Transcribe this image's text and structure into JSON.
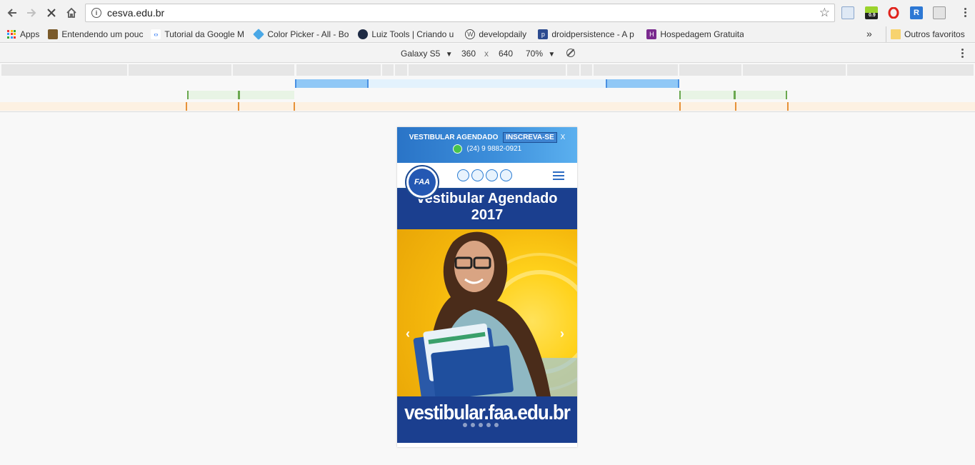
{
  "browser": {
    "url": "cesva.edu.br",
    "bookmarks": [
      {
        "label": "Apps"
      },
      {
        "label": "Entendendo um pouc"
      },
      {
        "label": "Tutorial da Google M"
      },
      {
        "label": "Color Picker - All - Bo"
      },
      {
        "label": "Luiz Tools | Criando u"
      },
      {
        "label": "developdaily"
      },
      {
        "label": "droidpersistence - A p"
      },
      {
        "label": "Hospedagem Gratuita"
      }
    ],
    "more_bookmarks": "»",
    "other_favorites": "Outros favoritos",
    "extension_badge": "0.9"
  },
  "device_toolbar": {
    "device": "Galaxy S5",
    "width": "360",
    "times": "x",
    "height": "640",
    "zoom": "70%"
  },
  "site": {
    "topbar": {
      "label": "VESTIBULAR AGENDADO",
      "button": "INSCREVA-SE",
      "close": "X",
      "phone": "(24) 9 9882-0921"
    },
    "logo_text": "FAA",
    "banner": {
      "title_line1": "vestibular Agendado",
      "title_line2": "2017",
      "url": "vestibular.faa.edu.br",
      "prev": "‹",
      "next": "›"
    }
  },
  "colors": {
    "brand_blue": "#1b3f8f",
    "accent_blue": "#2c7dd3",
    "banner_yellow": "#ffd21c",
    "media_blue": "#90c8f6",
    "media_green": "#6aa84f",
    "media_orange": "#e69138"
  }
}
